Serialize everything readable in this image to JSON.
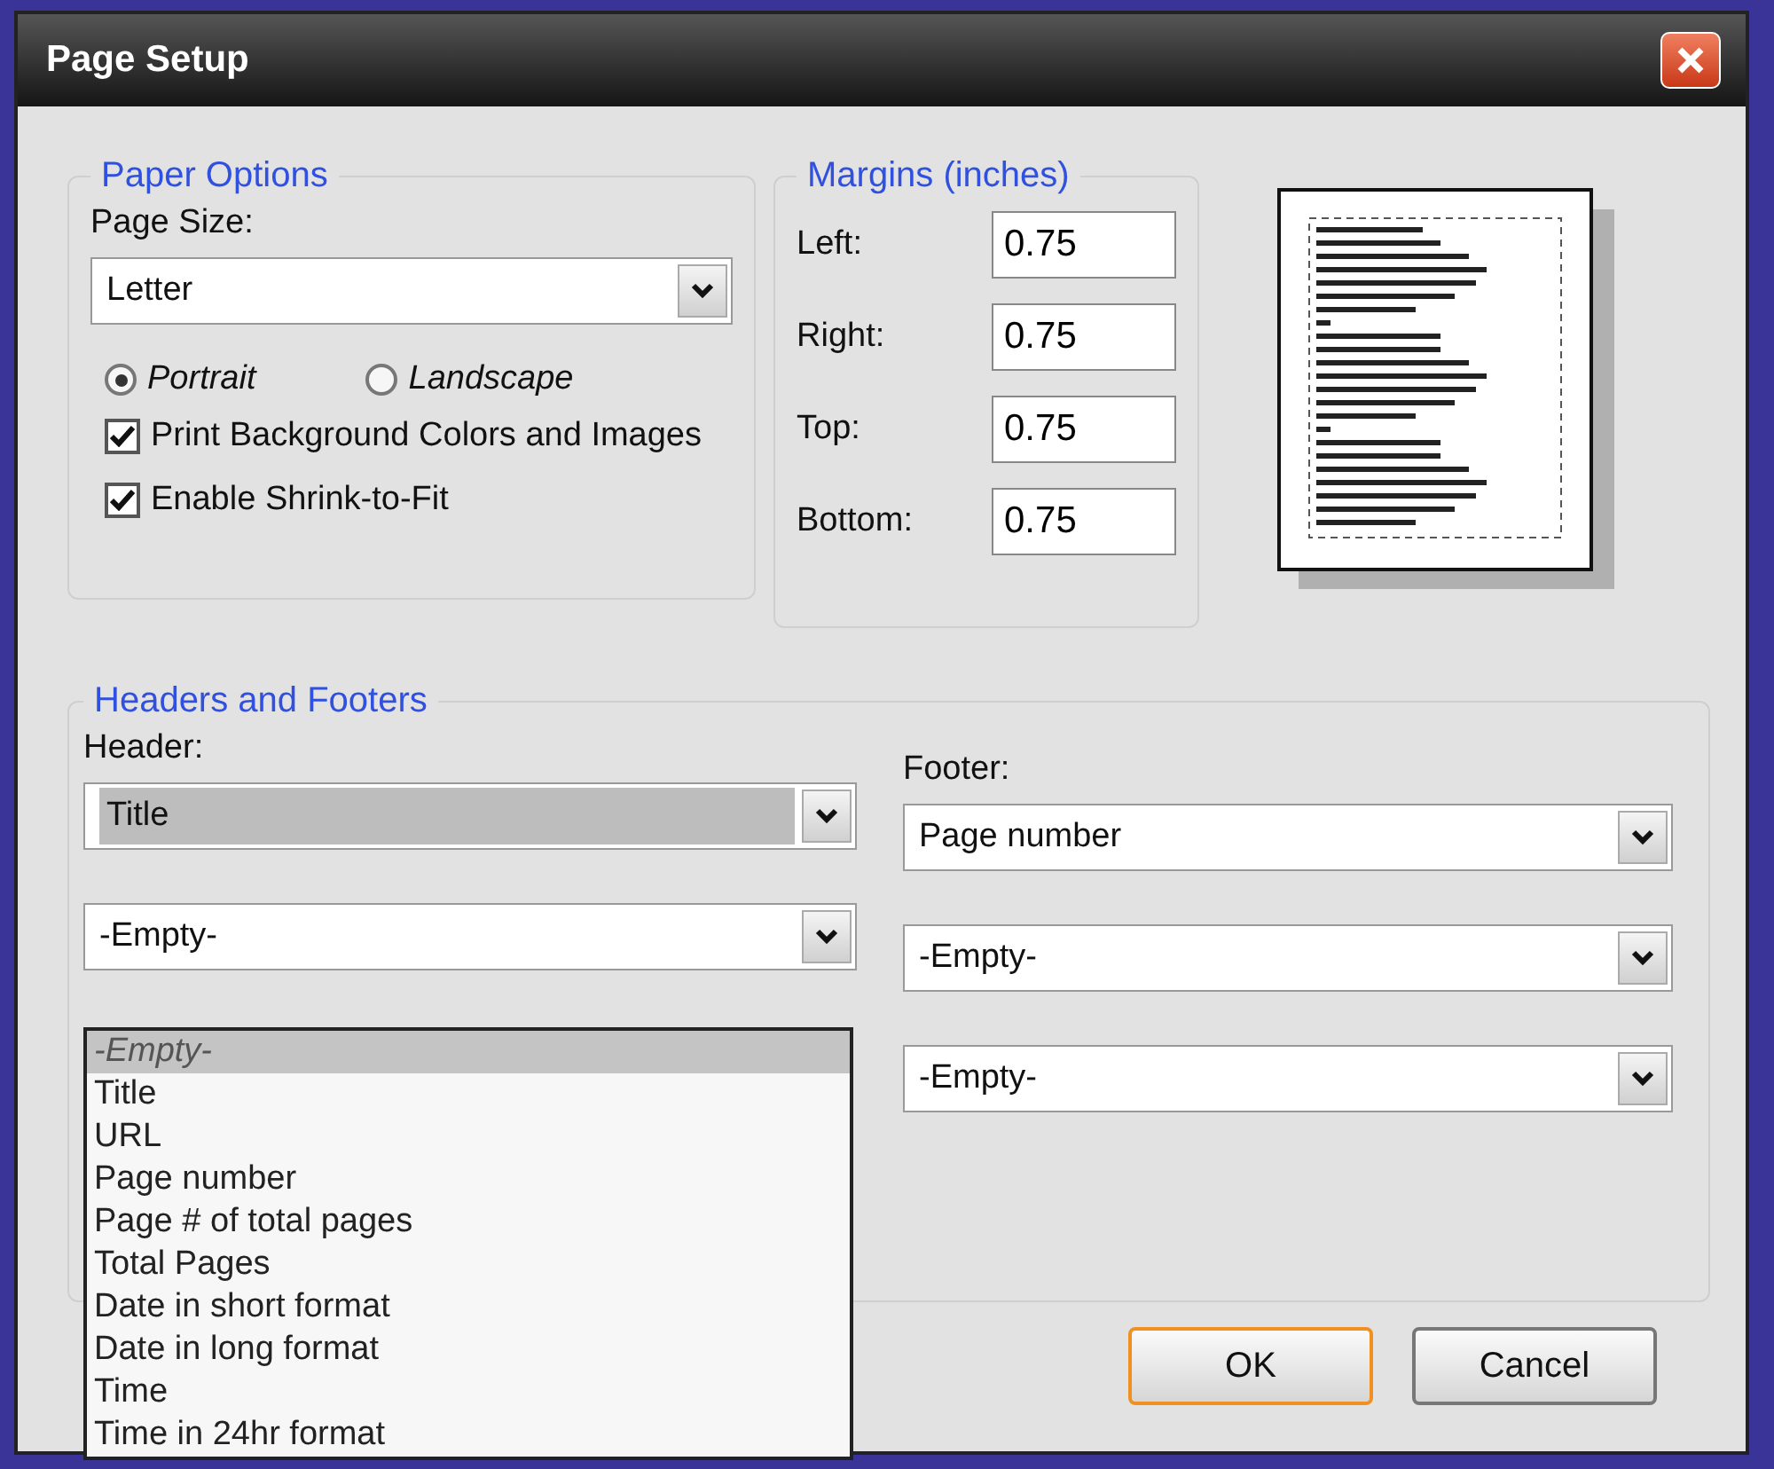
{
  "window": {
    "title": "Page Setup"
  },
  "paper_options": {
    "title": "Paper Options",
    "page_size_label": "Page Size:",
    "page_size": "Letter",
    "orientations": [
      {
        "label": "Portrait",
        "selected": true
      },
      {
        "label": "Landscape",
        "selected": false
      }
    ],
    "checkboxes": [
      {
        "label": "Print Background Colors and Images",
        "checked": true
      },
      {
        "label": "Enable Shrink-to-Fit",
        "checked": true
      }
    ]
  },
  "margins": {
    "title": "Margins (inches)",
    "fields": [
      {
        "label": "Left:",
        "value": "0.75"
      },
      {
        "label": "Right:",
        "value": "0.75"
      },
      {
        "label": "Top:",
        "value": "0.75"
      },
      {
        "label": "Bottom:",
        "value": "0.75"
      }
    ]
  },
  "headers_footers": {
    "title": "Headers and Footers",
    "header_label": "Header:",
    "footer_label": "Footer:",
    "header": [
      {
        "value": "Title",
        "focused": true
      },
      {
        "value": "-Empty-",
        "focused": false
      }
    ],
    "footer": [
      {
        "value": "Page number",
        "focused": false
      },
      {
        "value": "-Empty-",
        "focused": false
      },
      {
        "value": "-Empty-",
        "focused": false
      }
    ],
    "dropdown_list": [
      {
        "label": "-Empty-",
        "selected": true
      },
      {
        "label": "Title",
        "selected": false
      },
      {
        "label": "URL",
        "selected": false
      },
      {
        "label": "Page number",
        "selected": false
      },
      {
        "label": "Page # of total pages",
        "selected": false
      },
      {
        "label": "Total Pages",
        "selected": false
      },
      {
        "label": "Date in short format",
        "selected": false
      },
      {
        "label": "Date in long format",
        "selected": false
      },
      {
        "label": "Time",
        "selected": false
      },
      {
        "label": "Time in 24hr format",
        "selected": false
      }
    ]
  },
  "buttons": [
    {
      "label": "OK",
      "default": true
    },
    {
      "label": "Cancel",
      "default": false
    }
  ]
}
